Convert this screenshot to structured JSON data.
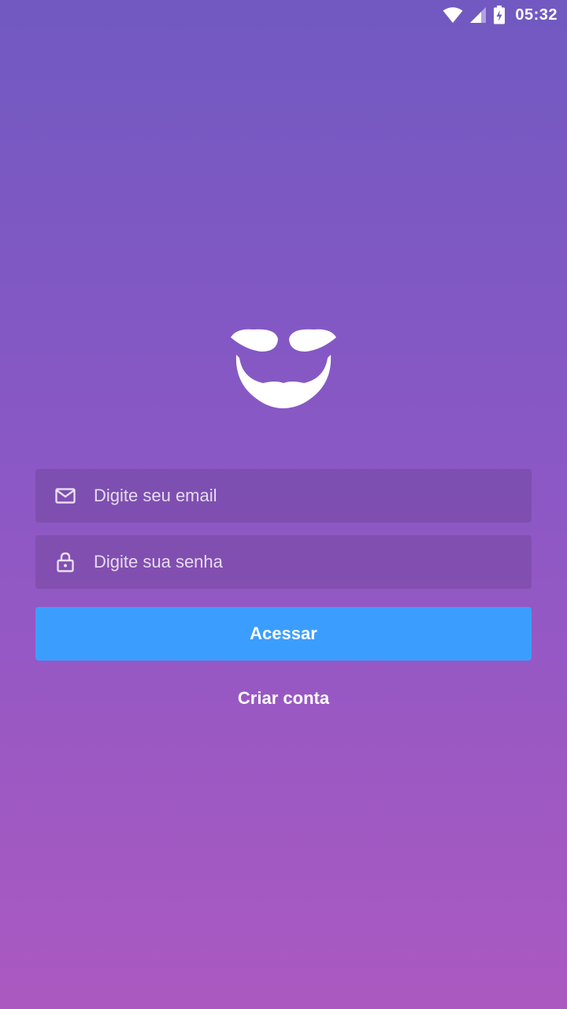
{
  "status_bar": {
    "time": "05:32",
    "icons": [
      "wifi-icon",
      "cellular-signal-icon",
      "battery-charging-icon"
    ]
  },
  "logo": {
    "icon": "mustache-beard-icon"
  },
  "form": {
    "email": {
      "icon": "mail-icon",
      "placeholder": "Digite seu email",
      "value": ""
    },
    "password": {
      "icon": "lock-icon",
      "placeholder": "Digite sua senha",
      "value": ""
    },
    "submit_label": "Acessar"
  },
  "create_account_label": "Criar conta",
  "colors": {
    "gradient_top": "#7159c1",
    "gradient_bottom": "#ab59c1",
    "button": "#3b9eff",
    "text": "#ffffff"
  }
}
